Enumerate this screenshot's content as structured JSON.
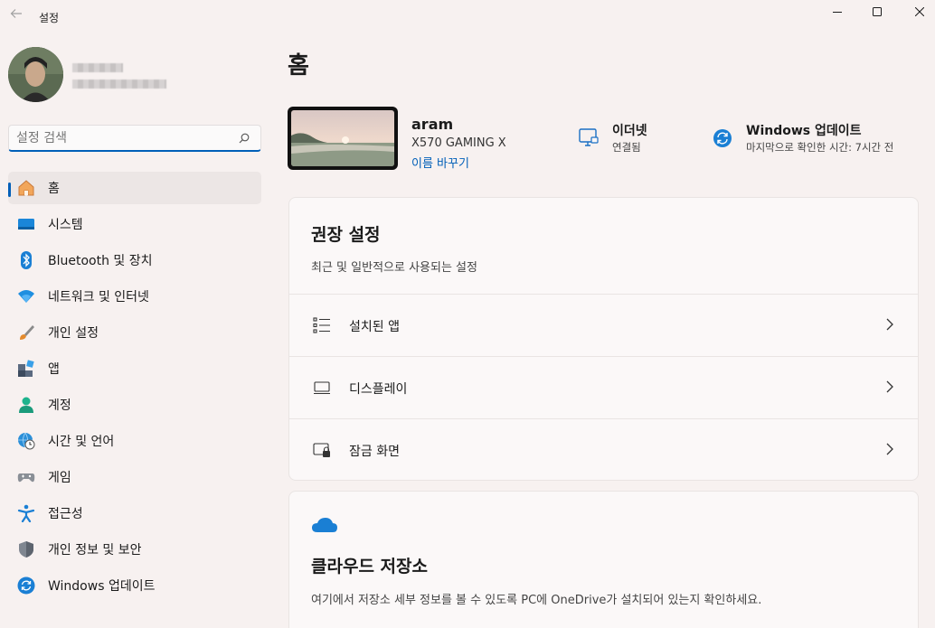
{
  "window": {
    "title": "설정"
  },
  "search": {
    "placeholder": "설정 검색"
  },
  "sidebar": {
    "items": [
      {
        "label": "홈",
        "icon": "home-icon",
        "active": true
      },
      {
        "label": "시스템",
        "icon": "system-icon"
      },
      {
        "label": "Bluetooth 및 장치",
        "icon": "bluetooth-icon"
      },
      {
        "label": "네트워크 및 인터넷",
        "icon": "wifi-icon"
      },
      {
        "label": "개인 설정",
        "icon": "brush-icon"
      },
      {
        "label": "앱",
        "icon": "apps-icon"
      },
      {
        "label": "계정",
        "icon": "account-icon"
      },
      {
        "label": "시간 및 언어",
        "icon": "globe-clock-icon"
      },
      {
        "label": "게임",
        "icon": "gamepad-icon"
      },
      {
        "label": "접근성",
        "icon": "accessibility-icon"
      },
      {
        "label": "개인 정보 및 보안",
        "icon": "shield-icon"
      },
      {
        "label": "Windows 업데이트",
        "icon": "update-icon"
      }
    ]
  },
  "main": {
    "title": "홈",
    "device": {
      "name": "aram",
      "model": "X570 GAMING X",
      "rename": "이름 바꾸기"
    },
    "ethernet": {
      "title": "이더넷",
      "status": "연결됨"
    },
    "update": {
      "title": "Windows 업데이트",
      "status": "마지막으로 확인한 시간: 7시간 전"
    },
    "recommended": {
      "title": "권장 설정",
      "subtitle": "최근 및 일반적으로 사용되는 설정",
      "rows": [
        {
          "label": "설치된 앱",
          "icon": "list-icon"
        },
        {
          "label": "디스플레이",
          "icon": "laptop-icon"
        },
        {
          "label": "잠금 화면",
          "icon": "lock-screen-icon"
        }
      ]
    },
    "cloud": {
      "title": "클라우드 저장소",
      "description": "여기에서 저장소 세부 정보를 볼 수 있도록 PC에 OneDrive가 설치되어 있는지 확인하세요."
    }
  },
  "colors": {
    "accent": "#005fb8",
    "background": "#f7f1f0",
    "card": "#fbf8f8"
  }
}
